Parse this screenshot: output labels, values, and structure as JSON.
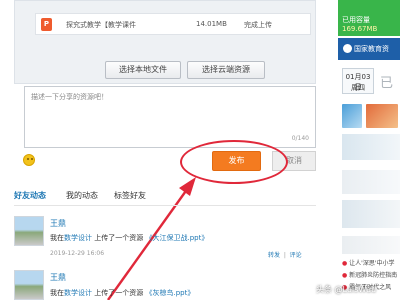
{
  "upload": {
    "file_icon": "ppt-file-icon",
    "file_icon_letter": "P",
    "file_name": "探究式教学【教学课件",
    "file_size": "14.01MB",
    "file_status": "完成上传",
    "local_button": "选择本地文件",
    "cloud_button": "选择云端资源"
  },
  "share": {
    "placeholder": "描述一下分享的资源吧！",
    "char_count": "0/140",
    "emoji_icon": "smiley-icon",
    "publish_button": "发布",
    "cancel_button": "取消"
  },
  "annotation": {
    "color": "#e0283a",
    "shapes": [
      "ellipse",
      "arrow"
    ]
  },
  "feed": {
    "tabs": [
      "好友动态",
      "我的动态",
      "标签好友"
    ],
    "items": [
      {
        "user": "王鼎",
        "prefix": "我在",
        "category": "数学设计",
        "middle": "上传了一个资源",
        "resource": "《大江保卫战.ppt》",
        "time": "2019-12-29 16:06",
        "actions": [
          "转发",
          "评论"
        ]
      },
      {
        "user": "王鼎",
        "prefix": "我在",
        "category": "数学设计",
        "middle": "上传了一个资源",
        "resource": "《灰椋鸟.ppt》"
      }
    ]
  },
  "sidebar": {
    "storage_label": "已用容量",
    "storage_value": "169.67MB",
    "cert_text": "国家教育资",
    "calendar_date": "01月03日",
    "calendar_weekday": "周四",
    "calendar_side": "已",
    "links": [
      "让人'深思'中小学",
      "新冠肺炎防控指南",
      "霸气于时代之风"
    ]
  },
  "watermark": "头条 @LuisWuu",
  "colors": {
    "accent": "#f47b20",
    "link": "#1f78b4",
    "annotation": "#e0283a",
    "storage": "#39b54a",
    "banner": "#1e5fa8"
  }
}
